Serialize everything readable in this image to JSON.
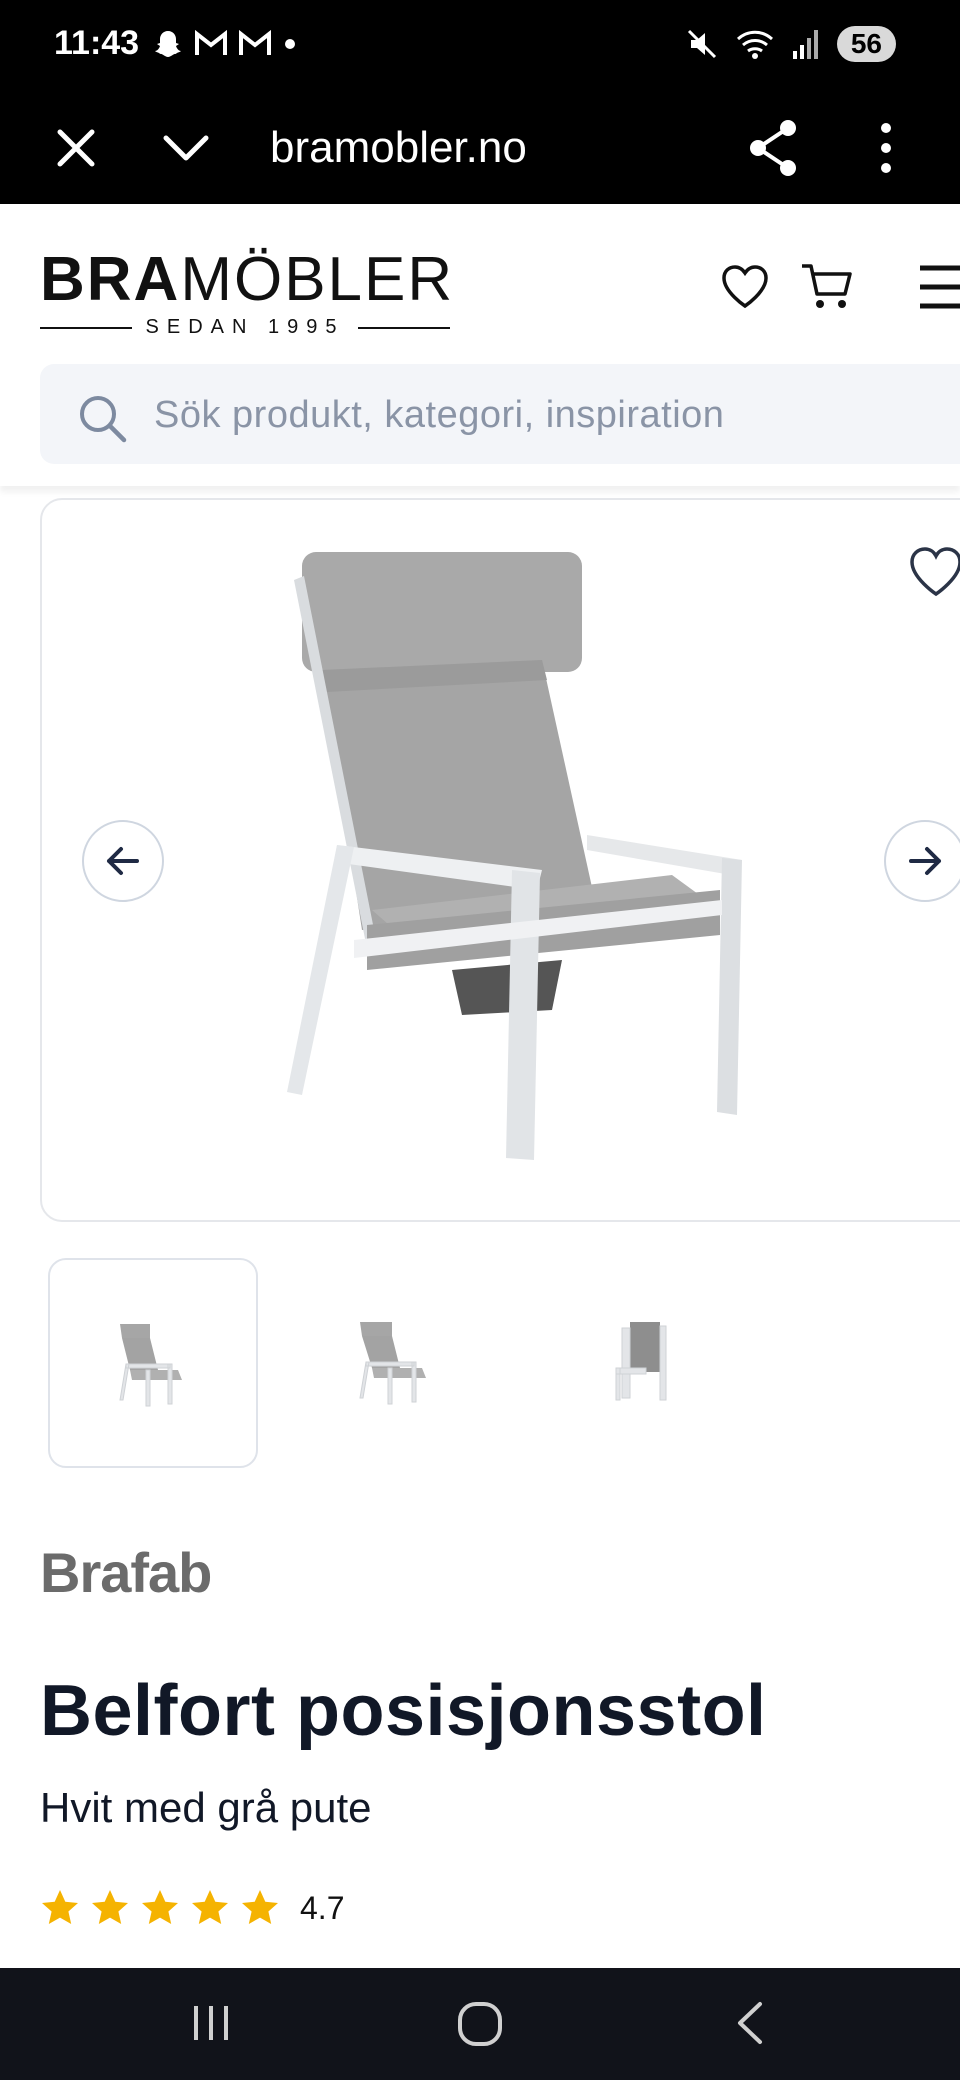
{
  "status_bar": {
    "time": "11:43",
    "battery": "56",
    "icons_left": [
      "snapchat-icon",
      "gmail-icon",
      "gmail-icon",
      "dot-icon"
    ],
    "icons_right": [
      "mute-icon",
      "wifi-icon",
      "signal-icon"
    ]
  },
  "browser": {
    "url": "bramobler.no",
    "icons": [
      "close-icon",
      "chevron-down-icon",
      "share-icon",
      "more-vert-icon"
    ]
  },
  "header": {
    "logo_bold": "BRA",
    "logo_light": "MÖBLER",
    "logo_tagline": "SEDAN 1995",
    "icons": [
      "heart-icon",
      "cart-icon",
      "hamburger-icon"
    ]
  },
  "search": {
    "placeholder": "Sök produkt, kategori, inspiration"
  },
  "product": {
    "brand": "Brafab",
    "title": "Belfort posisjonsstol",
    "subtitle": "Hvit med grå pute",
    "rating": "4.7",
    "rating_stars": 5,
    "thumbnail_count": 3,
    "active_thumbnail": 1
  },
  "colors": {
    "text_dark": "#111827",
    "star": "#f5b301",
    "brand_gray": "#6b6b6b",
    "search_bg": "#f3f5f9"
  }
}
